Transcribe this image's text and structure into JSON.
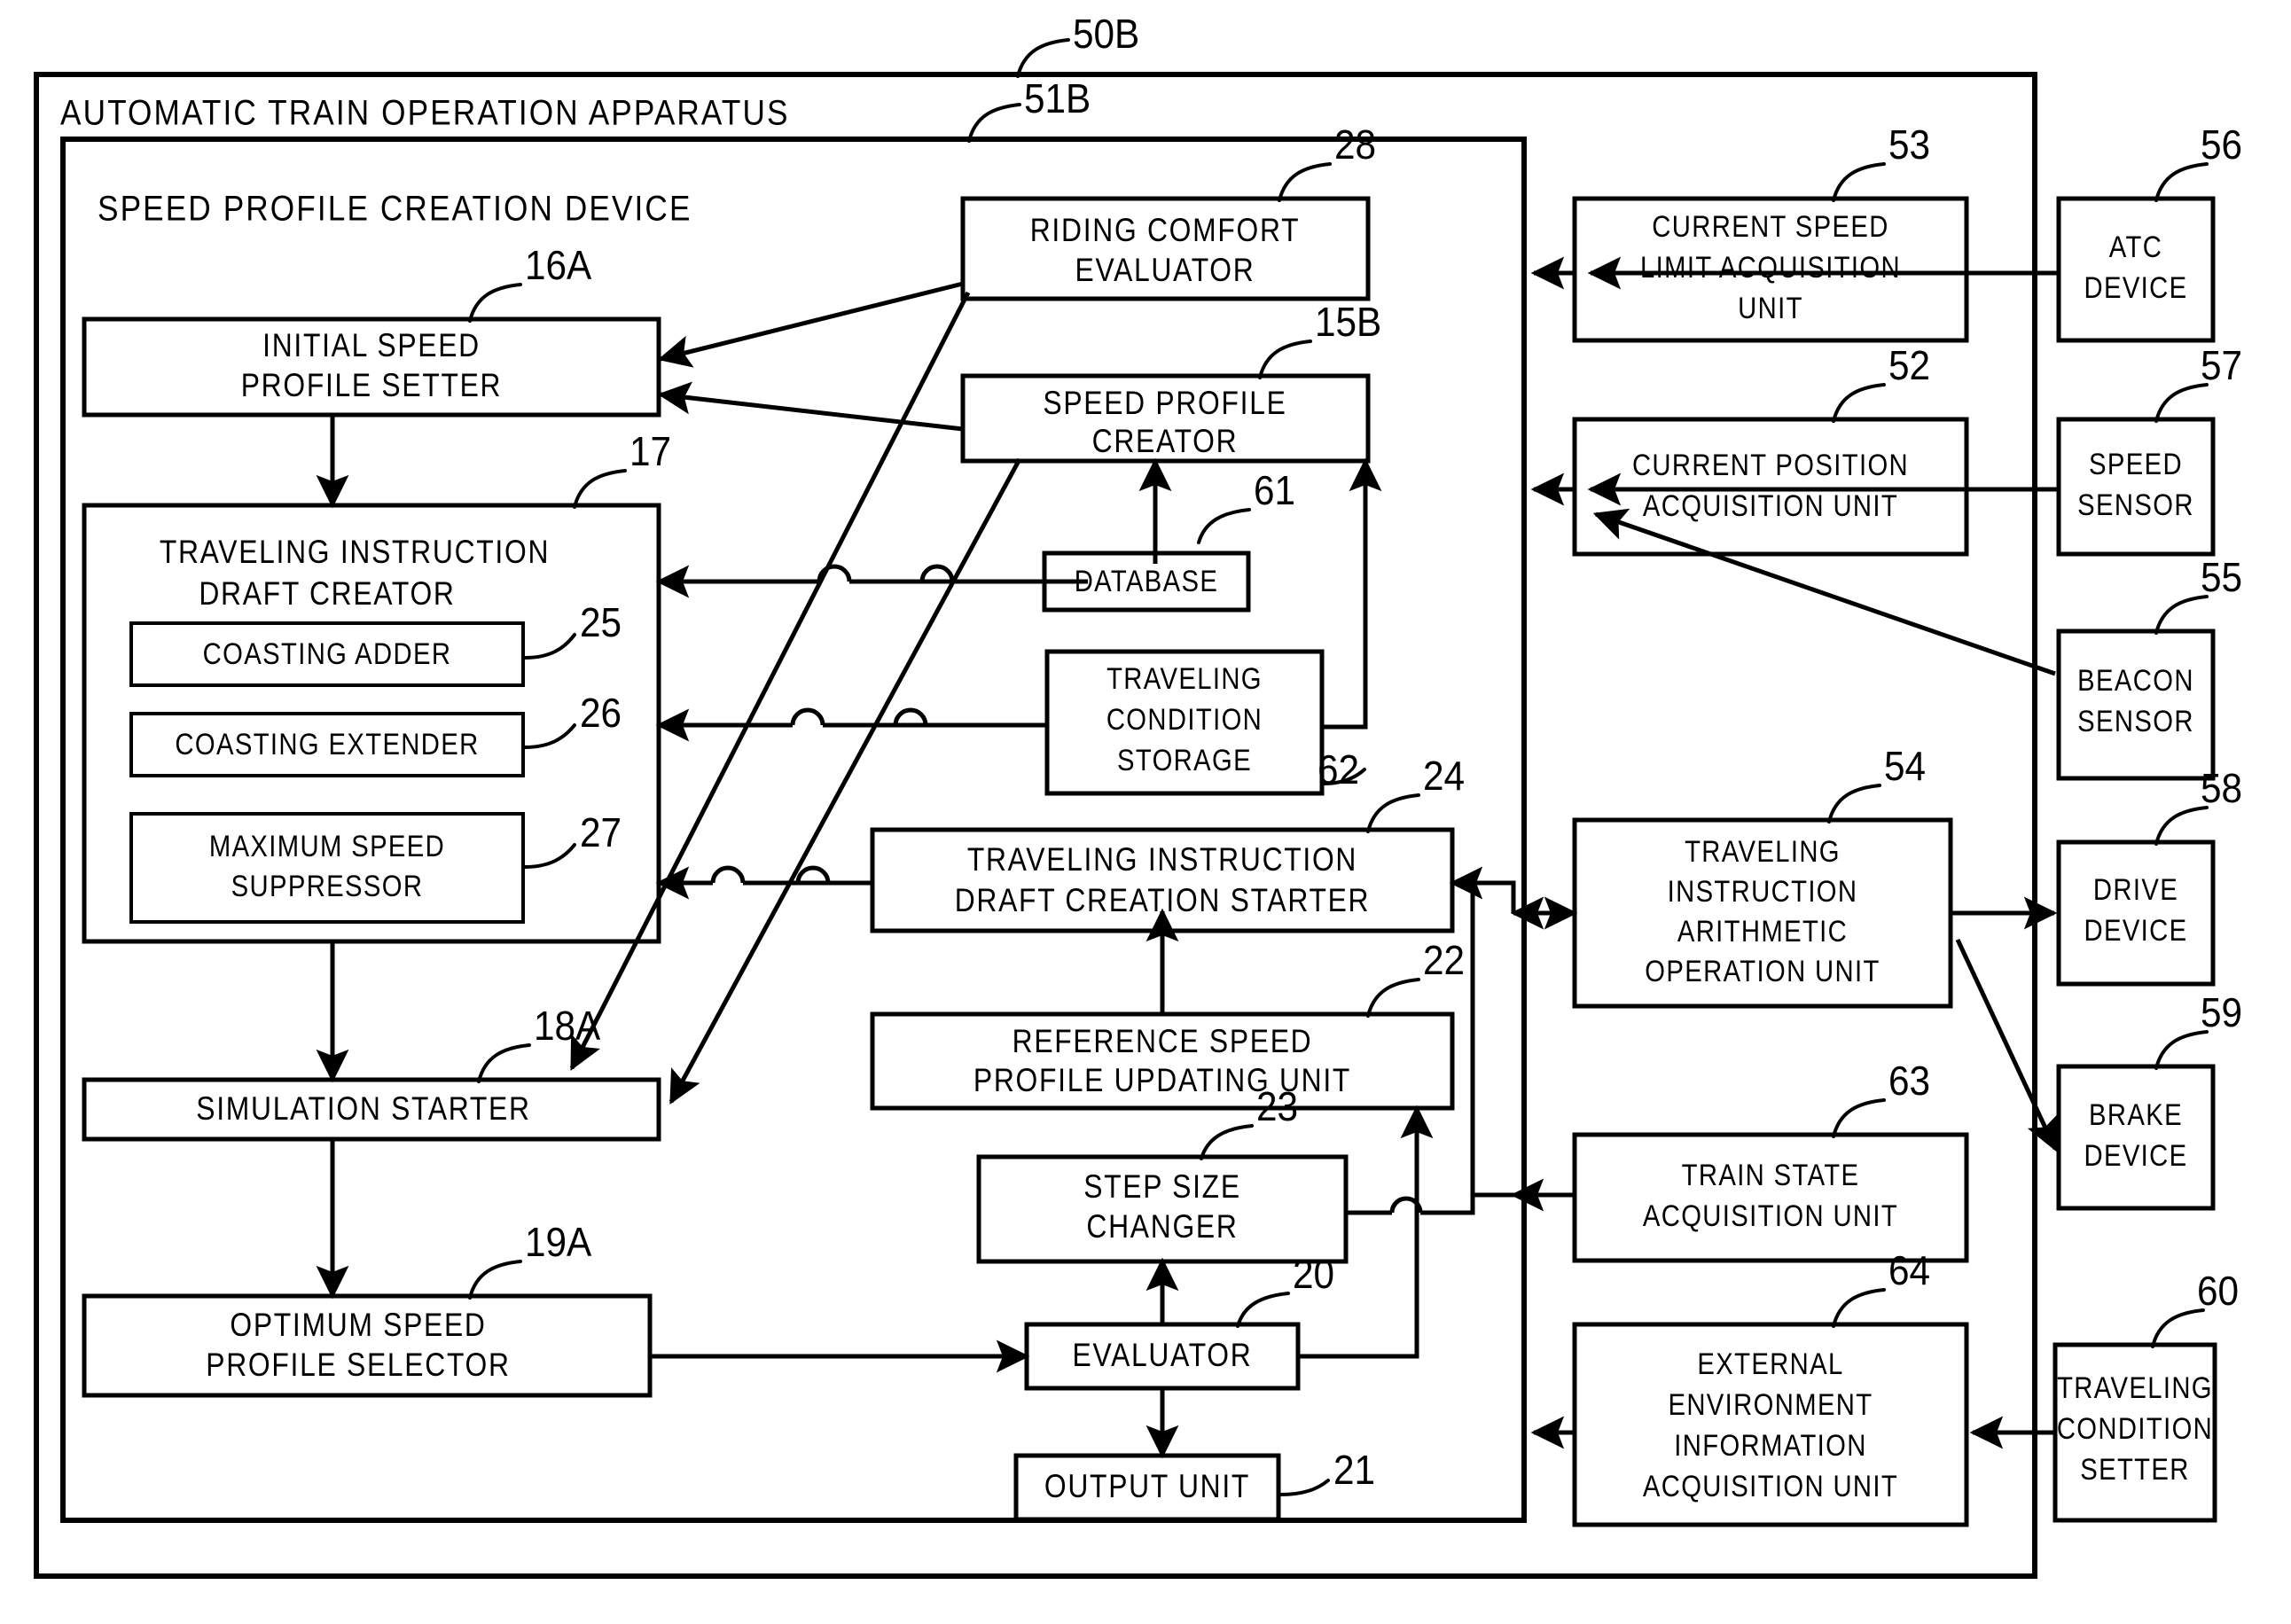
{
  "figure": {
    "type": "patent-block-diagram",
    "title": "AUTOMATIC TRAIN OPERATION APPARATUS",
    "outer_ref": "50B",
    "inner_title": "SPEED PROFILE CREATION DEVICE",
    "inner_ref": "51B"
  },
  "blocks": {
    "initial_speed_profile_setter": {
      "ref": "16A",
      "line1": "INITIAL SPEED",
      "line2": "PROFILE SETTER"
    },
    "traveling_instruction_draft_creator": {
      "ref": "17",
      "line1": "TRAVELING INSTRUCTION",
      "line2": "DRAFT CREATOR"
    },
    "coasting_adder": {
      "ref": "25",
      "line1": "COASTING ADDER"
    },
    "coasting_extender": {
      "ref": "26",
      "line1": "COASTING EXTENDER"
    },
    "maximum_speed_suppressor": {
      "ref": "27",
      "line1": "MAXIMUM SPEED",
      "line2": "SUPPRESSOR"
    },
    "simulation_starter": {
      "ref": "18A",
      "line1": "SIMULATION STARTER"
    },
    "optimum_speed_profile_selector": {
      "ref": "19A",
      "line1": "OPTIMUM SPEED",
      "line2": "PROFILE SELECTOR"
    },
    "riding_comfort_evaluator": {
      "ref": "28",
      "line1": "RIDING COMFORT",
      "line2": "EVALUATOR"
    },
    "speed_profile_creator": {
      "ref": "15B",
      "line1": "SPEED PROFILE",
      "line2": "CREATOR"
    },
    "database": {
      "ref": "61",
      "line1": "DATABASE"
    },
    "traveling_condition_storage": {
      "ref": "62",
      "line1": "TRAVELING",
      "line2": "CONDITION",
      "line3": "STORAGE"
    },
    "traveling_instruction_draft_creation_starter": {
      "ref": "24",
      "line1": "TRAVELING INSTRUCTION",
      "line2": "DRAFT CREATION STARTER"
    },
    "reference_speed_profile_updating_unit": {
      "ref": "22",
      "line1": "REFERENCE SPEED",
      "line2": "PROFILE UPDATING UNIT"
    },
    "step_size_changer": {
      "ref": "23",
      "line1": "STEP SIZE",
      "line2": "CHANGER"
    },
    "evaluator": {
      "ref": "20",
      "line1": "EVALUATOR"
    },
    "output_unit": {
      "ref": "21",
      "line1": "OUTPUT UNIT"
    },
    "current_speed_limit_acquisition_unit": {
      "ref": "53",
      "line1": "CURRENT SPEED",
      "line2": "LIMIT ACQUISITION",
      "line3": "UNIT"
    },
    "current_position_acquisition_unit": {
      "ref": "52",
      "line1": "CURRENT POSITION",
      "line2": "ACQUISITION UNIT"
    },
    "traveling_instruction_arithmetic_operation_unit": {
      "ref": "54",
      "line1": "TRAVELING",
      "line2": "INSTRUCTION",
      "line3": "ARITHMETIC",
      "line4": "OPERATION UNIT"
    },
    "train_state_acquisition_unit": {
      "ref": "63",
      "line1": "TRAIN STATE",
      "line2": "ACQUISITION UNIT"
    },
    "external_environment_information_acquisition_unit": {
      "ref": "64",
      "line1": "EXTERNAL",
      "line2": "ENVIRONMENT",
      "line3": "INFORMATION",
      "line4": "ACQUISITION UNIT"
    },
    "atc_device": {
      "ref": "56",
      "line1": "ATC",
      "line2": "DEVICE"
    },
    "speed_sensor": {
      "ref": "57",
      "line1": "SPEED",
      "line2": "SENSOR"
    },
    "beacon_sensor": {
      "ref": "55",
      "line1": "BEACON",
      "line2": "SENSOR"
    },
    "drive_device": {
      "ref": "58",
      "line1": "DRIVE",
      "line2": "DEVICE"
    },
    "brake_device": {
      "ref": "59",
      "line1": "BRAKE",
      "line2": "DEVICE"
    },
    "traveling_condition_setter": {
      "ref": "60",
      "line1": "TRAVELING",
      "line2": "CONDITION",
      "line3": "SETTER"
    }
  },
  "colors": {
    "ink": "#000000",
    "paper": "#ffffff"
  }
}
